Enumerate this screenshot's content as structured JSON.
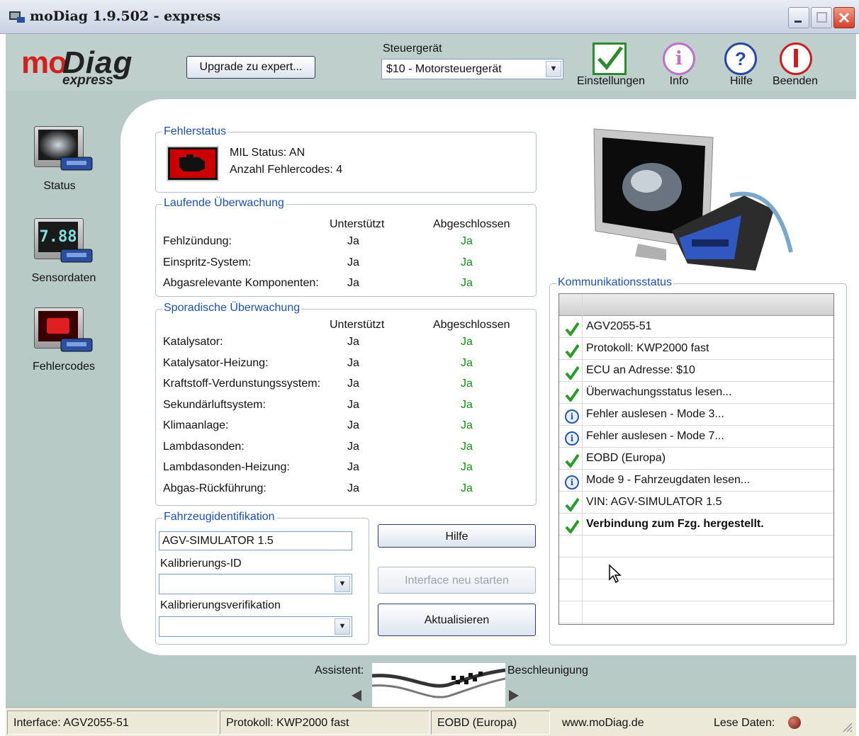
{
  "window": {
    "title": "moDiag 1.9.502 - express"
  },
  "logo": {
    "mo": "mo",
    "diag": "Diag",
    "sub": "express"
  },
  "header": {
    "upgrade_label": "Upgrade zu expert...",
    "ecu_label": "Steuergerät",
    "ecu_value": "$10 - Motorsteuergerät",
    "tools": [
      {
        "label": "Einstellungen",
        "icon": "checkmark-icon"
      },
      {
        "label": "Info",
        "icon": "info-icon"
      },
      {
        "label": "Hilfe",
        "icon": "help-icon"
      },
      {
        "label": "Beenden",
        "icon": "power-icon"
      }
    ]
  },
  "nav": [
    {
      "label": "Status",
      "screen": ""
    },
    {
      "label": "Sensordaten",
      "screen": "7.88"
    },
    {
      "label": "Fehlercodes",
      "screen": ""
    }
  ],
  "fehlerstatus": {
    "title": "Fehlerstatus",
    "mil": "MIL Status: AN",
    "count": "Anzahl Fehlercodes: 4"
  },
  "laufend": {
    "title": "Laufende Überwachung",
    "col1": "Unterstützt",
    "col2": "Abgeschlossen",
    "rows": [
      {
        "name": "Fehlzündung:",
        "s": "Ja",
        "a": "Ja"
      },
      {
        "name": "Einspritz-System:",
        "s": "Ja",
        "a": "Ja"
      },
      {
        "name": "Abgasrelevante Komponenten:",
        "s": "Ja",
        "a": "Ja"
      }
    ]
  },
  "sporadisch": {
    "title": "Sporadische Überwachung",
    "col1": "Unterstützt",
    "col2": "Abgeschlossen",
    "rows": [
      {
        "name": "Katalysator:",
        "s": "Ja",
        "a": "Ja"
      },
      {
        "name": "Katalysator-Heizung:",
        "s": "Ja",
        "a": "Ja"
      },
      {
        "name": "Kraftstoff-Verdunstungssystem:",
        "s": "Ja",
        "a": "Ja"
      },
      {
        "name": "Sekundärluftsystem:",
        "s": "Ja",
        "a": "Ja"
      },
      {
        "name": "Klimaanlage:",
        "s": "Ja",
        "a": "Ja"
      },
      {
        "name": "Lambdasonden:",
        "s": "Ja",
        "a": "Ja"
      },
      {
        "name": "Lambdasonden-Heizung:",
        "s": "Ja",
        "a": "Ja"
      },
      {
        "name": "Abgas-Rückführung:",
        "s": "Ja",
        "a": "Ja"
      }
    ]
  },
  "fahrzeug": {
    "title": "Fahrzeugidentifikation",
    "vin_value": "AGV-SIMULATOR 1.5",
    "kal_id_label": "Kalibrierungs-ID",
    "kal_id_value": "",
    "kal_ver_label": "Kalibrierungsverifikation",
    "kal_ver_value": ""
  },
  "actions": {
    "hilfe": "Hilfe",
    "restart": "Interface neu starten",
    "refresh": "Aktualisieren"
  },
  "komm": {
    "title": "Kommunikationsstatus",
    "rows": [
      {
        "icon": "check",
        "text": "AGV2055-51",
        "bold": false
      },
      {
        "icon": "check",
        "text": "Protokoll: KWP2000 fast",
        "bold": false
      },
      {
        "icon": "check",
        "text": "ECU an Adresse: $10",
        "bold": false
      },
      {
        "icon": "check",
        "text": "Überwachungsstatus lesen...",
        "bold": false
      },
      {
        "icon": "info",
        "text": "Fehler auslesen - Mode 3...",
        "bold": false
      },
      {
        "icon": "info",
        "text": "Fehler auslesen - Mode 7...",
        "bold": false
      },
      {
        "icon": "check",
        "text": "EOBD (Europa)",
        "bold": false
      },
      {
        "icon": "info",
        "text": "Mode 9 - Fahrzeugdaten lesen...",
        "bold": false
      },
      {
        "icon": "check",
        "text": "VIN: AGV-SIMULATOR 1.5",
        "bold": false
      },
      {
        "icon": "check",
        "text": "Verbindung zum Fzg. hergestellt.",
        "bold": true
      }
    ]
  },
  "assistant": {
    "label": "Assistent:",
    "next": "Beschleunigung"
  },
  "statusbar": {
    "interface": "Interface: AGV2055-51",
    "protocol": "Protokoll: KWP2000 fast",
    "standard": "EOBD (Europa)",
    "website": "www.moDiag.de",
    "lese": "Lese Daten:"
  },
  "colors": {
    "accent": "#d2201f",
    "ok": "#1a8a1a",
    "group_title": "#2050a0"
  }
}
